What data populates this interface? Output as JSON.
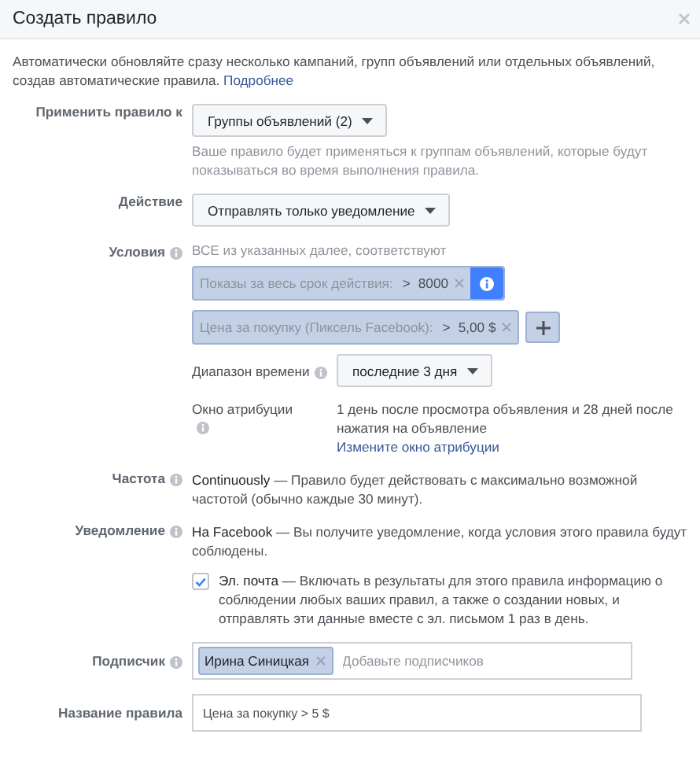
{
  "dialog": {
    "title": "Создать правило"
  },
  "intro": {
    "text": "Автоматически обновляйте сразу несколько кампаний, групп объявлений или отдельных объявлений, создав автоматические правила.",
    "link": "Подробнее"
  },
  "apply_to": {
    "label": "Применить правило к",
    "value": "Группы объявлений (2)",
    "hint": "Ваше правило будет применяться к группам объявлений, которые будут показываться во время выполнения правила."
  },
  "action": {
    "label": "Действие",
    "value": "Отправлять только уведомление"
  },
  "conditions": {
    "label": "Условия",
    "summary": "ВСЕ из указанных далее, соответствуют",
    "filters": [
      {
        "metric": "Показы за весь срок действия:",
        "operator": ">",
        "value": "8000",
        "focused": true
      },
      {
        "metric": "Цена за покупку (Пиксель Facebook):",
        "operator": ">",
        "value": "5,00 $",
        "focused": false
      }
    ],
    "time_range": {
      "label": "Диапазон времени",
      "value": "последние 3 дня"
    },
    "attribution": {
      "label": "Окно атрибуции",
      "text": "1 день после просмотра объявления и 28 дней после нажатия на объявление",
      "link": "Измените окно атрибуции"
    }
  },
  "frequency": {
    "label": "Частота",
    "text": "**Continuously** — Правило будет действовать с максимально возможной частотой (обычно каждые 30 минут)."
  },
  "notification": {
    "label": "Уведомление",
    "text": "**На Facebook** — Вы получите уведомление, когда условия этого правила будут соблюдены.",
    "email": {
      "checked": true,
      "text": "**Эл. почта** — Включать в результаты для этого правила информацию о соблюдении любых ваших правил, а также о создании новых, и отправлять эти данные вместе с эл. письмом 1 раз в день."
    }
  },
  "subscriber": {
    "label": "Подписчик",
    "tokens": [
      "Ирина Синицкая"
    ],
    "placeholder": "Добавьте подписчиков"
  },
  "rule_name": {
    "label": "Название правила",
    "value": "Цена за покупку > 5 $"
  }
}
